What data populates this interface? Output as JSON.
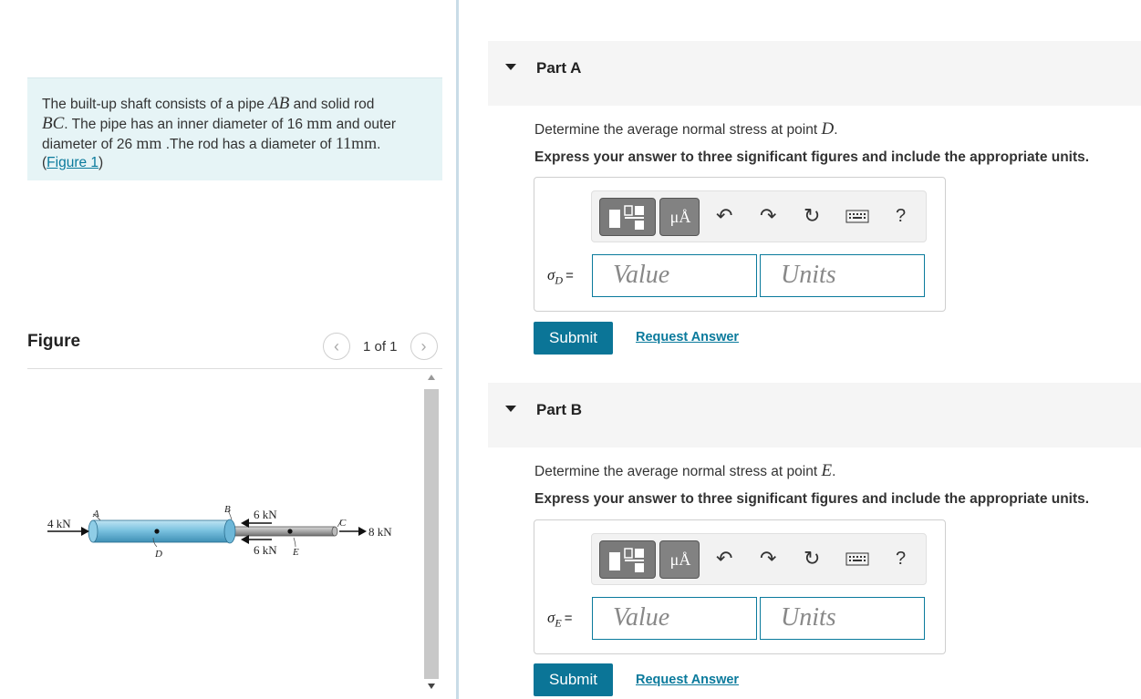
{
  "problem": {
    "t1": "The built-up shaft consists of a pipe ",
    "ab": "AB",
    "t2": " and solid rod",
    "bc": "BC",
    "t3": ". The pipe has an inner diameter of 16 ",
    "mm1": "mm",
    "t4": " and outer",
    "t5": "diameter of 26 ",
    "mm2": "mm",
    "t6": " .The rod has a diameter of ",
    "val11": "11mm",
    "t7": ".",
    "open_paren": "(",
    "link": "Figure 1",
    "close_paren": ")"
  },
  "figure": {
    "title": "Figure",
    "counter": "1 of 1",
    "prev": "‹",
    "next": "›",
    "labels": {
      "force_left": "4 kN",
      "a": "A",
      "b": "B",
      "c": "C",
      "d": "D",
      "e": "E",
      "force_top": "6 kN",
      "force_bottom": "6 kN",
      "force_right": "8 kN"
    }
  },
  "partA": {
    "title": "Part A",
    "question_prefix": "Determine the average normal stress at point ",
    "point": "D",
    "question_suffix": ".",
    "instruction": "Express your answer to three significant figures and include the appropriate units.",
    "sigma": "σ",
    "sub": "D",
    "equals": "=",
    "value_placeholder": "Value",
    "units_placeholder": "Units",
    "submit": "Submit",
    "request": "Request Answer"
  },
  "partB": {
    "title": "Part B",
    "question_prefix": "Determine the average normal stress at point ",
    "point": "E",
    "question_suffix": ".",
    "instruction": "Express your answer to three significant figures and include the appropriate units.",
    "sigma": "σ",
    "sub": "E",
    "equals": "=",
    "value_placeholder": "Value",
    "units_placeholder": "Units",
    "submit": "Submit",
    "request": "Request Answer"
  },
  "toolbar": {
    "mu_label": "μÅ",
    "help": "?",
    "icons": [
      "templates-icon",
      "units-icon",
      "undo-icon",
      "redo-icon",
      "reset-icon",
      "keyboard-icon",
      "help-icon"
    ]
  }
}
